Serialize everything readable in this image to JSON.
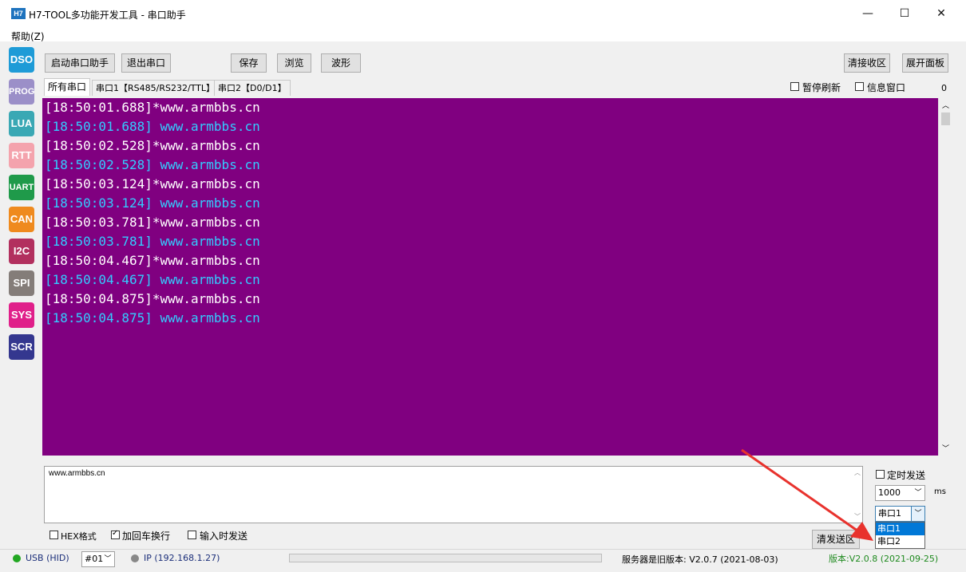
{
  "window": {
    "icon_text": "H7",
    "title": "H7-TOOL多功能开发工具 - 串口助手",
    "minimize": "—",
    "maximize": "☐",
    "close": "✕"
  },
  "menu": {
    "help": "帮助(Z)"
  },
  "tools": [
    {
      "label": "DSO",
      "color": "#1e9bd7"
    },
    {
      "label": "PROG",
      "color": "#9b8fc8"
    },
    {
      "label": "LUA",
      "color": "#3aa8b4"
    },
    {
      "label": "RTT",
      "color": "#f4a3ad"
    },
    {
      "label": "UART",
      "color": "#1f9a4a"
    },
    {
      "label": "CAN",
      "color": "#ef8a1e"
    },
    {
      "label": "I2C",
      "color": "#b2305e"
    },
    {
      "label": "SPI",
      "color": "#847d79"
    },
    {
      "label": "SYS",
      "color": "#e0208a"
    },
    {
      "label": "SCR",
      "color": "#34378f"
    }
  ],
  "toolbar": {
    "start": "启动串口助手",
    "exit": "退出串口",
    "save": "保存",
    "browse": "浏览",
    "wave": "波形",
    "clear_recv": "清接收区",
    "expand": "展开面板"
  },
  "tabs": {
    "all": "所有串口",
    "port1": "串口1【RS485/RS232/TTL】",
    "port2": "串口2【D0/D1】"
  },
  "options": {
    "pause": "暂停刷新",
    "info_window": "信息窗口",
    "count": "0"
  },
  "log_colors": {
    "white": "#ffffff",
    "cyan": "#33ccff",
    "background": "#800080"
  },
  "log": [
    {
      "text": "[18:50:01.688]*www.armbbs.cn",
      "color": "white"
    },
    {
      "text": "[18:50:01.688] www.armbbs.cn",
      "color": "cyan"
    },
    {
      "text": "[18:50:02.528]*www.armbbs.cn",
      "color": "white"
    },
    {
      "text": "[18:50:02.528] www.armbbs.cn",
      "color": "cyan"
    },
    {
      "text": "[18:50:03.124]*www.armbbs.cn",
      "color": "white"
    },
    {
      "text": "[18:50:03.124] www.armbbs.cn",
      "color": "cyan"
    },
    {
      "text": "[18:50:03.781]*www.armbbs.cn",
      "color": "white"
    },
    {
      "text": "[18:50:03.781] www.armbbs.cn",
      "color": "cyan"
    },
    {
      "text": "[18:50:04.467]*www.armbbs.cn",
      "color": "white"
    },
    {
      "text": "[18:50:04.467] www.armbbs.cn",
      "color": "cyan"
    },
    {
      "text": "[18:50:04.875]*www.armbbs.cn",
      "color": "white"
    },
    {
      "text": "[18:50:04.875] www.armbbs.cn",
      "color": "cyan"
    }
  ],
  "send": {
    "text": "www.armbbs.cn",
    "hex": "HEX格式",
    "crlf": "加回车换行",
    "send_on_input": "输入时发送",
    "clear_send": "清发送区",
    "timed_send": "定时发送",
    "interval": "1000",
    "interval_unit": "ms",
    "port_selected": "串口1",
    "port_options": [
      "串口1",
      "串口2"
    ]
  },
  "status": {
    "usb": "USB (HID)",
    "device": "#01",
    "ip": "IP (192.168.1.27)",
    "server_version": "服务器是旧版本: V2.0.7 (2021-08-03)",
    "version": "版本:V2.0.8 (2021-09-25)"
  }
}
